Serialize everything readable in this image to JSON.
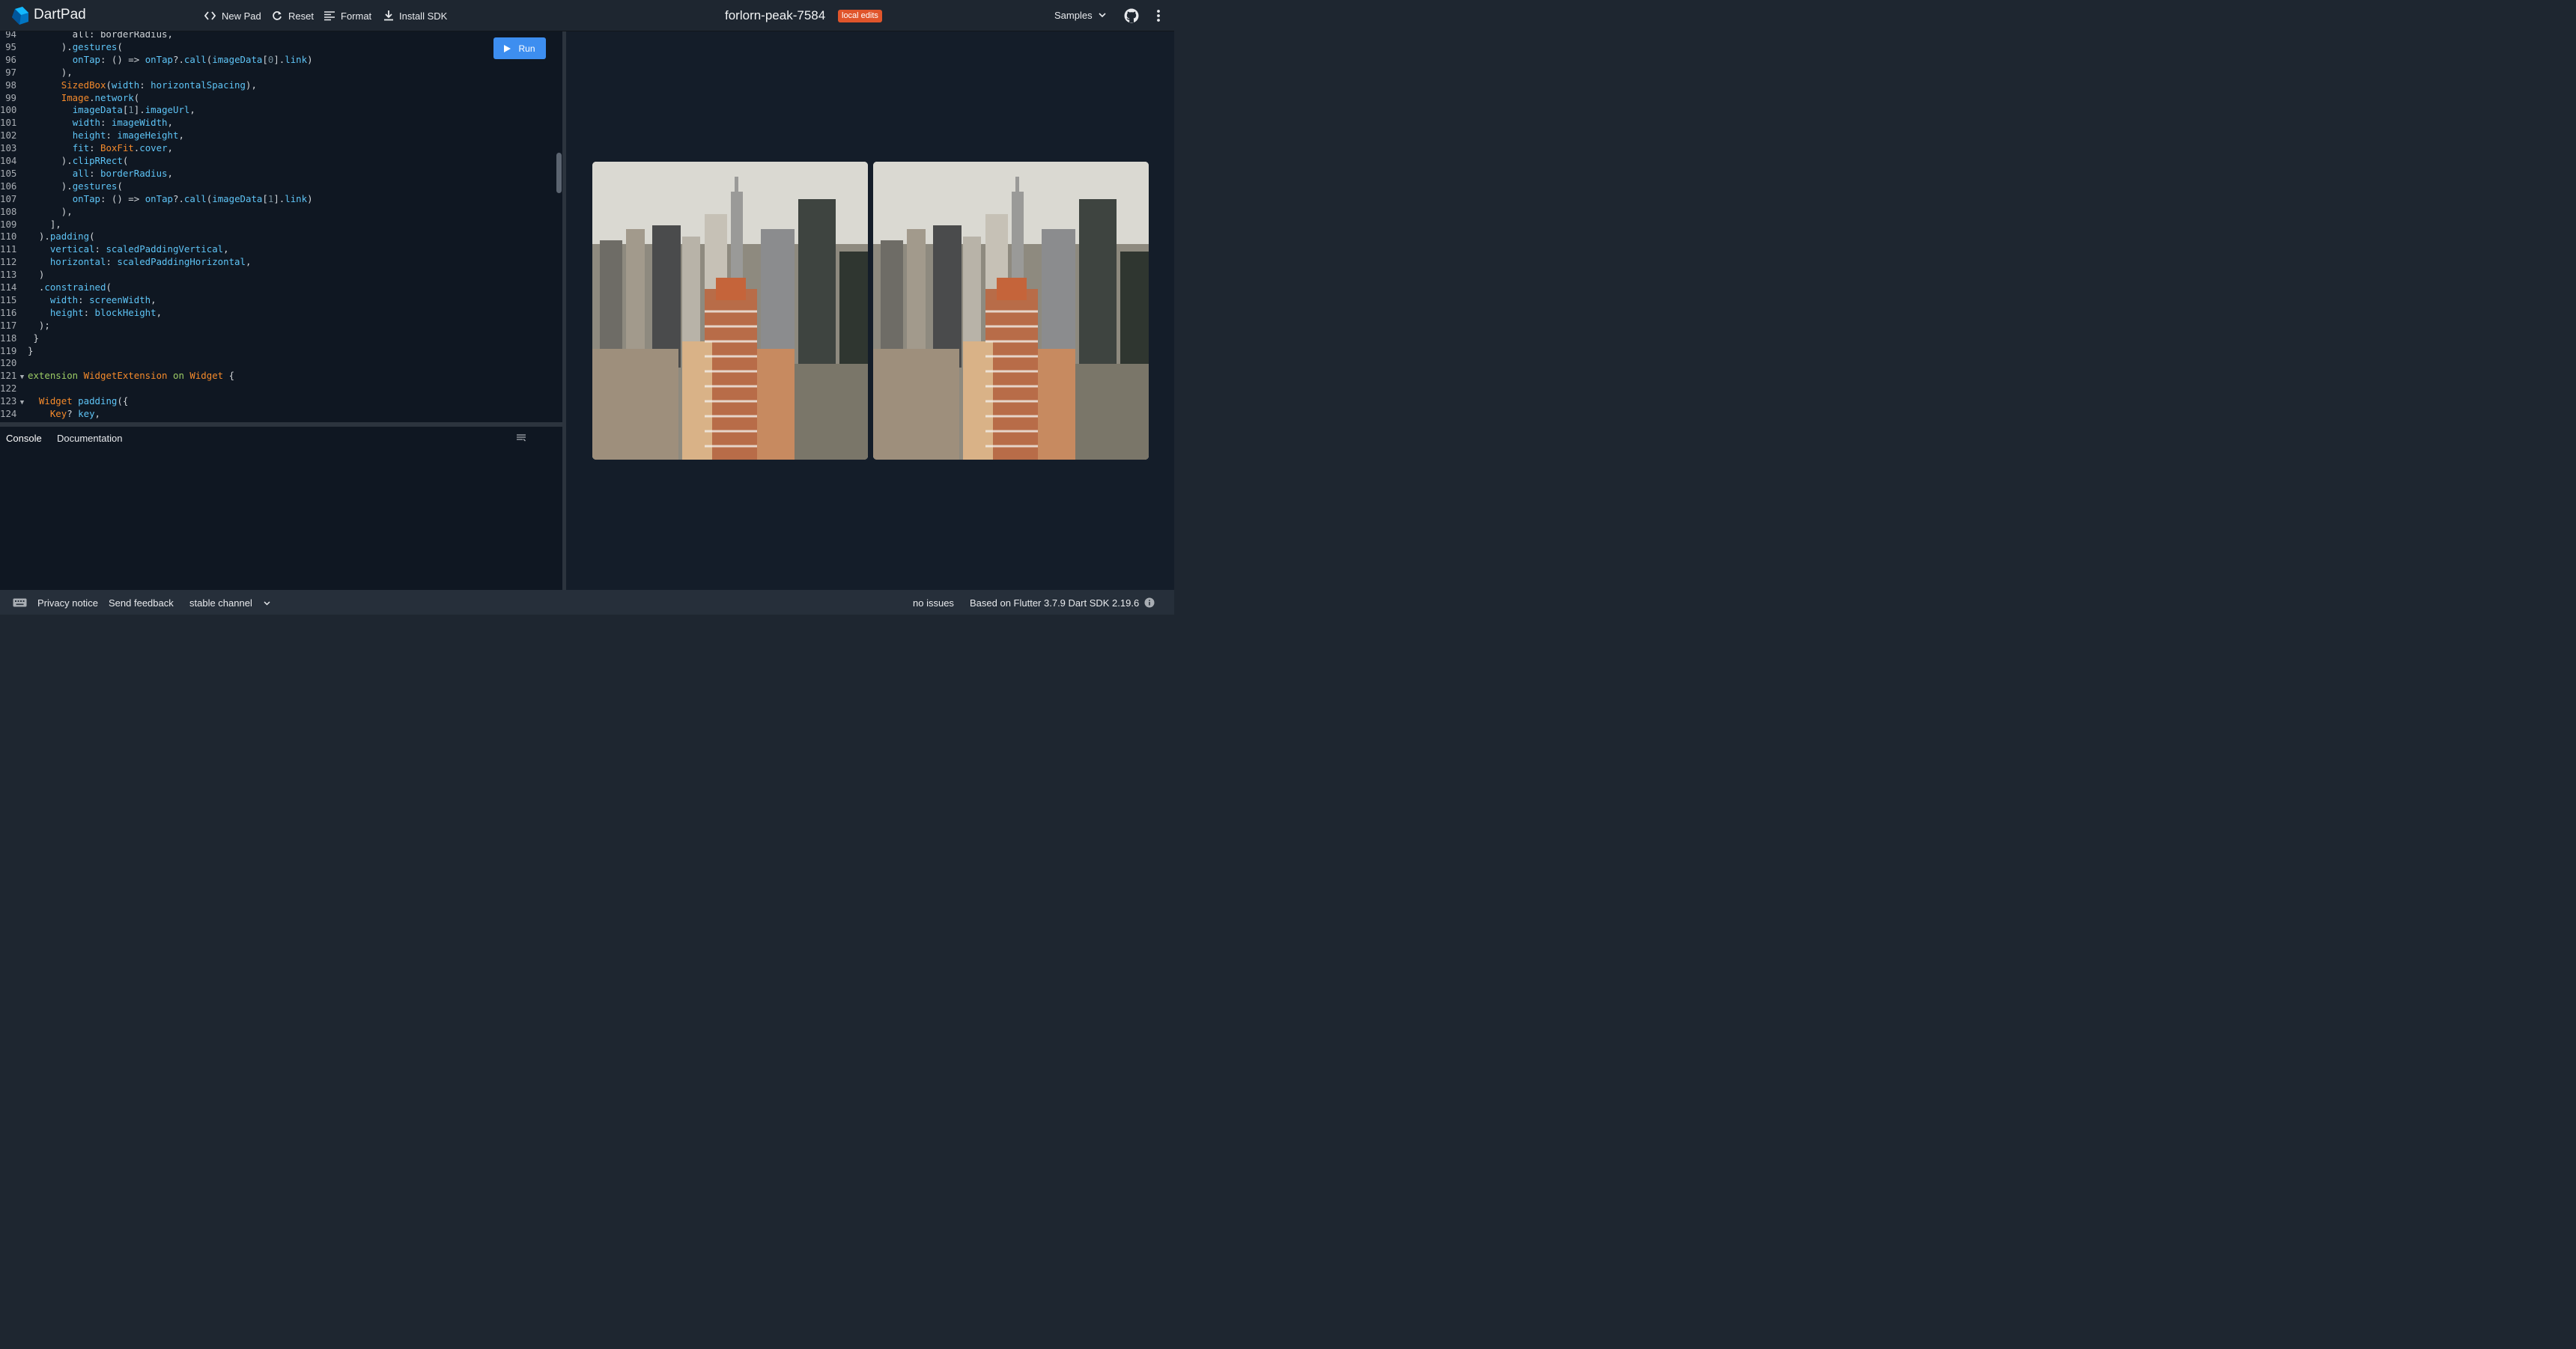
{
  "header": {
    "app_title": "DartPad",
    "new_pad_label": "New Pad",
    "reset_label": "Reset",
    "format_label": "Format",
    "install_sdk_label": "Install SDK",
    "pad_name": "forlorn-peak-7584",
    "badge": "local edits",
    "samples_label": "Samples"
  },
  "editor": {
    "run_label": "Run",
    "lines": [
      {
        "n": "94",
        "fold": "",
        "spans": [
          {
            "c": "k",
            "t": "        all: borderRadius,"
          }
        ]
      },
      {
        "n": "95",
        "fold": "",
        "spans": [
          {
            "c": "k",
            "t": "      )."
          },
          {
            "c": "p",
            "t": "gestures"
          },
          {
            "c": "k",
            "t": "("
          }
        ]
      },
      {
        "n": "96",
        "fold": "",
        "spans": [
          {
            "c": "k",
            "t": "        "
          },
          {
            "c": "p",
            "t": "onTap"
          },
          {
            "c": "k",
            "t": ": () => "
          },
          {
            "c": "p",
            "t": "onTap"
          },
          {
            "c": "k",
            "t": "?."
          },
          {
            "c": "p",
            "t": "call"
          },
          {
            "c": "k",
            "t": "("
          },
          {
            "c": "p",
            "t": "imageData"
          },
          {
            "c": "k",
            "t": "["
          },
          {
            "c": "num",
            "t": "0"
          },
          {
            "c": "k",
            "t": "]."
          },
          {
            "c": "p",
            "t": "link"
          },
          {
            "c": "k",
            "t": ")"
          }
        ]
      },
      {
        "n": "97",
        "fold": "",
        "spans": [
          {
            "c": "k",
            "t": "      ),"
          }
        ]
      },
      {
        "n": "98",
        "fold": "",
        "spans": [
          {
            "c": "k",
            "t": "      "
          },
          {
            "c": "t",
            "t": "SizedBox"
          },
          {
            "c": "k",
            "t": "("
          },
          {
            "c": "p",
            "t": "width"
          },
          {
            "c": "k",
            "t": ": "
          },
          {
            "c": "p",
            "t": "horizontalSpacing"
          },
          {
            "c": "k",
            "t": "),"
          }
        ]
      },
      {
        "n": "99",
        "fold": "",
        "spans": [
          {
            "c": "k",
            "t": "      "
          },
          {
            "c": "t",
            "t": "Image"
          },
          {
            "c": "k",
            "t": "."
          },
          {
            "c": "p",
            "t": "network"
          },
          {
            "c": "k",
            "t": "("
          }
        ]
      },
      {
        "n": "100",
        "fold": "",
        "spans": [
          {
            "c": "k",
            "t": "        "
          },
          {
            "c": "p",
            "t": "imageData"
          },
          {
            "c": "k",
            "t": "["
          },
          {
            "c": "num",
            "t": "1"
          },
          {
            "c": "k",
            "t": "]."
          },
          {
            "c": "p",
            "t": "imageUrl"
          },
          {
            "c": "k",
            "t": ","
          }
        ]
      },
      {
        "n": "101",
        "fold": "",
        "spans": [
          {
            "c": "k",
            "t": "        "
          },
          {
            "c": "p",
            "t": "width"
          },
          {
            "c": "k",
            "t": ": "
          },
          {
            "c": "p",
            "t": "imageWidth"
          },
          {
            "c": "k",
            "t": ","
          }
        ]
      },
      {
        "n": "102",
        "fold": "",
        "spans": [
          {
            "c": "k",
            "t": "        "
          },
          {
            "c": "p",
            "t": "height"
          },
          {
            "c": "k",
            "t": ": "
          },
          {
            "c": "p",
            "t": "imageHeight"
          },
          {
            "c": "k",
            "t": ","
          }
        ]
      },
      {
        "n": "103",
        "fold": "",
        "spans": [
          {
            "c": "k",
            "t": "        "
          },
          {
            "c": "p",
            "t": "fit"
          },
          {
            "c": "k",
            "t": ": "
          },
          {
            "c": "t",
            "t": "BoxFit"
          },
          {
            "c": "k",
            "t": "."
          },
          {
            "c": "p",
            "t": "cover"
          },
          {
            "c": "k",
            "t": ","
          }
        ]
      },
      {
        "n": "104",
        "fold": "",
        "spans": [
          {
            "c": "k",
            "t": "      )."
          },
          {
            "c": "p",
            "t": "clipRRect"
          },
          {
            "c": "k",
            "t": "("
          }
        ]
      },
      {
        "n": "105",
        "fold": "",
        "spans": [
          {
            "c": "k",
            "t": "        "
          },
          {
            "c": "p",
            "t": "all"
          },
          {
            "c": "k",
            "t": ": "
          },
          {
            "c": "p",
            "t": "borderRadius"
          },
          {
            "c": "k",
            "t": ","
          }
        ]
      },
      {
        "n": "106",
        "fold": "",
        "spans": [
          {
            "c": "k",
            "t": "      )."
          },
          {
            "c": "p",
            "t": "gestures"
          },
          {
            "c": "k",
            "t": "("
          }
        ]
      },
      {
        "n": "107",
        "fold": "",
        "spans": [
          {
            "c": "k",
            "t": "        "
          },
          {
            "c": "p",
            "t": "onTap"
          },
          {
            "c": "k",
            "t": ": () => "
          },
          {
            "c": "p",
            "t": "onTap"
          },
          {
            "c": "k",
            "t": "?."
          },
          {
            "c": "p",
            "t": "call"
          },
          {
            "c": "k",
            "t": "("
          },
          {
            "c": "p",
            "t": "imageData"
          },
          {
            "c": "k",
            "t": "["
          },
          {
            "c": "num",
            "t": "1"
          },
          {
            "c": "k",
            "t": "]."
          },
          {
            "c": "p",
            "t": "link"
          },
          {
            "c": "k",
            "t": ")"
          }
        ]
      },
      {
        "n": "108",
        "fold": "",
        "spans": [
          {
            "c": "k",
            "t": "      ),"
          }
        ]
      },
      {
        "n": "109",
        "fold": "",
        "spans": [
          {
            "c": "k",
            "t": "    ],"
          }
        ]
      },
      {
        "n": "110",
        "fold": "",
        "spans": [
          {
            "c": "k",
            "t": "  )."
          },
          {
            "c": "p",
            "t": "padding"
          },
          {
            "c": "k",
            "t": "("
          }
        ]
      },
      {
        "n": "111",
        "fold": "",
        "spans": [
          {
            "c": "k",
            "t": "    "
          },
          {
            "c": "p",
            "t": "vertical"
          },
          {
            "c": "k",
            "t": ": "
          },
          {
            "c": "p",
            "t": "scaledPaddingVertical"
          },
          {
            "c": "k",
            "t": ","
          }
        ]
      },
      {
        "n": "112",
        "fold": "",
        "spans": [
          {
            "c": "k",
            "t": "    "
          },
          {
            "c": "p",
            "t": "horizontal"
          },
          {
            "c": "k",
            "t": ": "
          },
          {
            "c": "p",
            "t": "scaledPaddingHorizontal"
          },
          {
            "c": "k",
            "t": ","
          }
        ]
      },
      {
        "n": "113",
        "fold": "",
        "spans": [
          {
            "c": "k",
            "t": "  )"
          }
        ]
      },
      {
        "n": "114",
        "fold": "",
        "spans": [
          {
            "c": "k",
            "t": "  ."
          },
          {
            "c": "p",
            "t": "constrained"
          },
          {
            "c": "k",
            "t": "("
          }
        ]
      },
      {
        "n": "115",
        "fold": "",
        "spans": [
          {
            "c": "k",
            "t": "    "
          },
          {
            "c": "p",
            "t": "width"
          },
          {
            "c": "k",
            "t": ": "
          },
          {
            "c": "p",
            "t": "screenWidth"
          },
          {
            "c": "k",
            "t": ","
          }
        ]
      },
      {
        "n": "116",
        "fold": "",
        "spans": [
          {
            "c": "k",
            "t": "    "
          },
          {
            "c": "p",
            "t": "height"
          },
          {
            "c": "k",
            "t": ": "
          },
          {
            "c": "p",
            "t": "blockHeight"
          },
          {
            "c": "k",
            "t": ","
          }
        ]
      },
      {
        "n": "117",
        "fold": "",
        "spans": [
          {
            "c": "k",
            "t": "  );"
          }
        ]
      },
      {
        "n": "118",
        "fold": "",
        "spans": [
          {
            "c": "k",
            "t": " }"
          }
        ]
      },
      {
        "n": "119",
        "fold": "",
        "spans": [
          {
            "c": "k",
            "t": "}"
          }
        ]
      },
      {
        "n": "120",
        "fold": "",
        "spans": []
      },
      {
        "n": "121",
        "fold": "▼",
        "spans": [
          {
            "c": "ext",
            "t": "extension"
          },
          {
            "c": "k",
            "t": " "
          },
          {
            "c": "t",
            "t": "WidgetExtension"
          },
          {
            "c": "k",
            "t": " "
          },
          {
            "c": "ext",
            "t": "on"
          },
          {
            "c": "k",
            "t": " "
          },
          {
            "c": "t",
            "t": "Widget"
          },
          {
            "c": "k",
            "t": " {"
          }
        ]
      },
      {
        "n": "122",
        "fold": "",
        "spans": []
      },
      {
        "n": "123",
        "fold": "▼",
        "spans": [
          {
            "c": "k",
            "t": "  "
          },
          {
            "c": "t",
            "t": "Widget"
          },
          {
            "c": "k",
            "t": " "
          },
          {
            "c": "p",
            "t": "padding"
          },
          {
            "c": "k",
            "t": "({"
          }
        ]
      },
      {
        "n": "124",
        "fold": "",
        "spans": [
          {
            "c": "k",
            "t": "    "
          },
          {
            "c": "t",
            "t": "Key"
          },
          {
            "c": "k",
            "t": "? "
          },
          {
            "c": "p",
            "t": "key"
          },
          {
            "c": "k",
            "t": ","
          }
        ]
      }
    ]
  },
  "console": {
    "tab_console": "Console",
    "tab_documentation": "Documentation"
  },
  "footer": {
    "privacy_label": "Privacy notice",
    "feedback_label": "Send feedback",
    "channel_label": "stable channel",
    "issues_label": "no issues",
    "version_label": "Based on Flutter 3.7.9 Dart SDK 2.19.6"
  },
  "colors": {
    "accent": "#3d8ef0",
    "badge": "#e0552b",
    "editor_bg": "#0f1722",
    "chrome_bg": "#1e2630"
  },
  "icons": [
    "dart-logo-icon",
    "code-icon",
    "refresh-icon",
    "format-icon",
    "download-icon",
    "chevron-down-icon",
    "github-icon",
    "more-vert-icon",
    "play-icon",
    "clear-console-icon",
    "keyboard-icon",
    "info-icon"
  ]
}
